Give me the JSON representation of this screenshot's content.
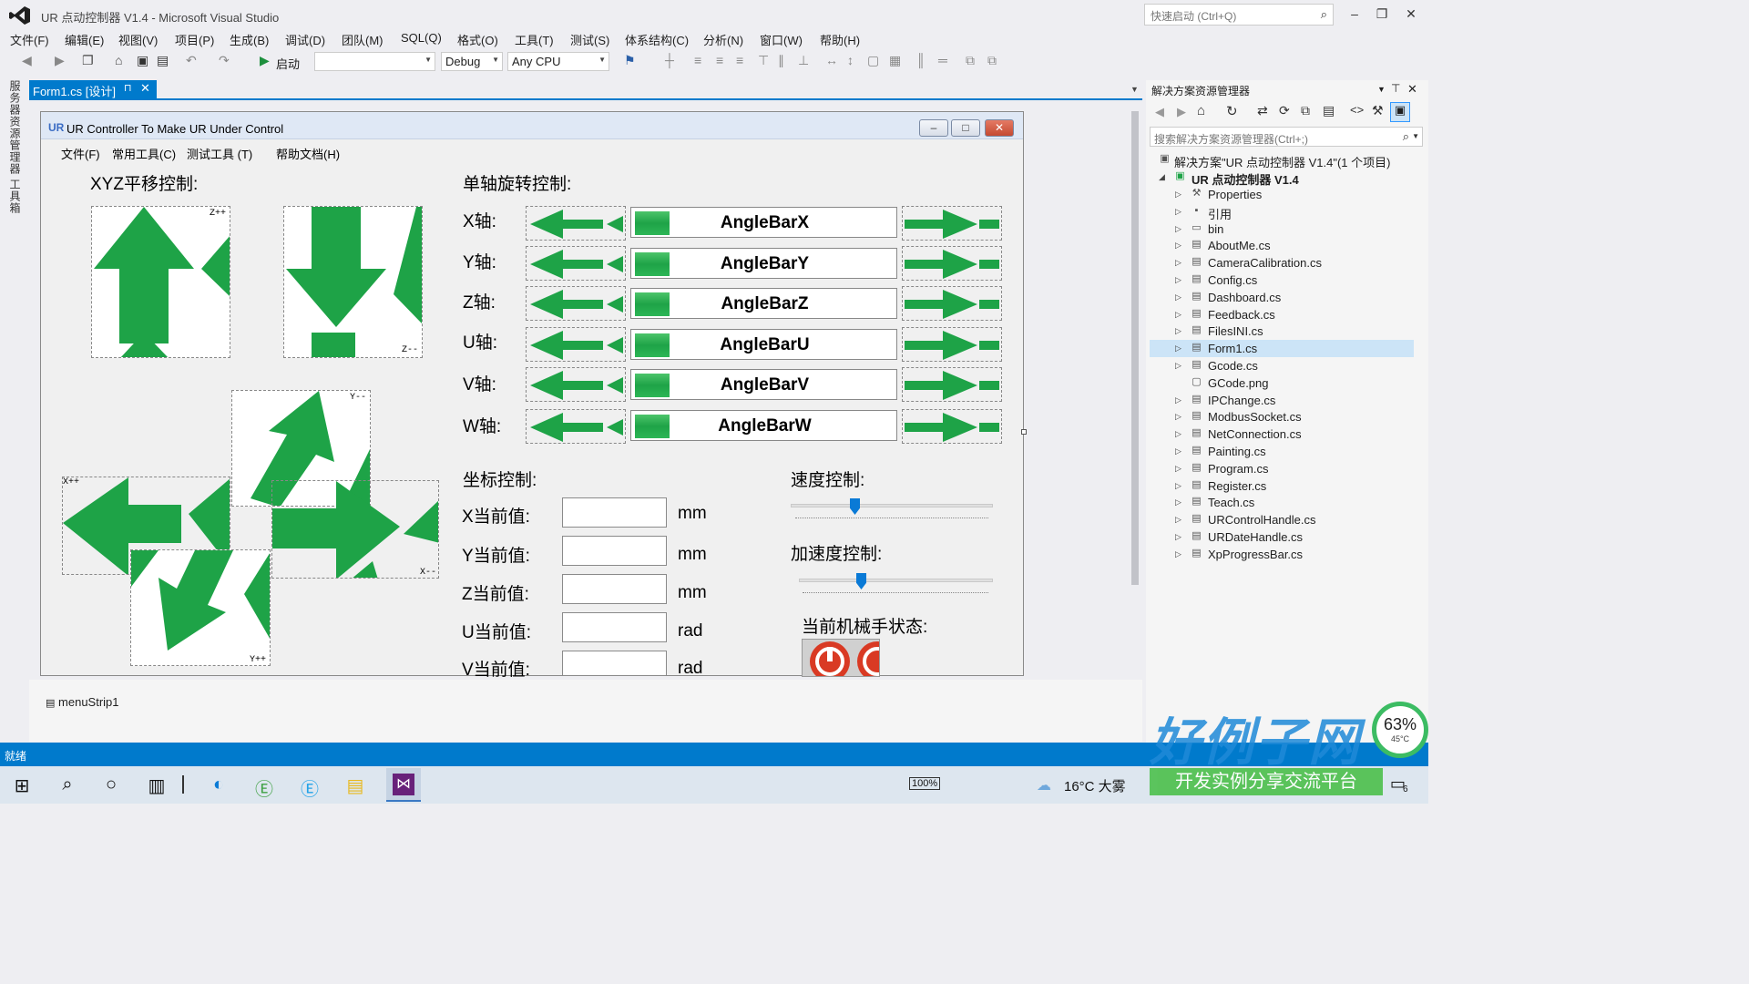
{
  "window": {
    "title": "UR 点动控制器 V1.4 - Microsoft Visual Studio",
    "quick_launch_placeholder": "快速启动 (Ctrl+Q)"
  },
  "menu": [
    "文件(F)",
    "编辑(E)",
    "视图(V)",
    "项目(P)",
    "生成(B)",
    "调试(D)",
    "团队(M)",
    "SQL(Q)",
    "格式(O)",
    "工具(T)",
    "测试(S)",
    "体系结构(C)",
    "分析(N)",
    "窗口(W)",
    "帮助(H)"
  ],
  "toolbar": {
    "start_label": "启动",
    "config": "Debug",
    "platform": "Any CPU"
  },
  "left_strip": [
    "服务器资源管理器",
    "工具箱"
  ],
  "doc_tab": {
    "label": "Form1.cs [设计]"
  },
  "form": {
    "title": "UR Controller  To Make UR Under Control",
    "logo": "UR",
    "menu": [
      "文件(F)",
      "常用工具(C)",
      "测试工具 (T)",
      "帮助文档(H)"
    ],
    "xyz_title": "XYZ平移控制:",
    "rot_title": "单轴旋转控制:",
    "tags": {
      "zp": "Z++",
      "zm": "Z--",
      "yp": "Y++",
      "ym": "Y--",
      "xp": "X++",
      "xm": "X--"
    },
    "axes": [
      {
        "label": "X轴:",
        "bar": "AngleBarX"
      },
      {
        "label": "Y轴:",
        "bar": "AngleBarY"
      },
      {
        "label": "Z轴:",
        "bar": "AngleBarZ"
      },
      {
        "label": "U轴:",
        "bar": "AngleBarU"
      },
      {
        "label": "V轴:",
        "bar": "AngleBarV"
      },
      {
        "label": "W轴:",
        "bar": "AngleBarW"
      }
    ],
    "coord_title": "坐标控制:",
    "coords": [
      {
        "label": "X当前值:",
        "unit": "mm"
      },
      {
        "label": "Y当前值:",
        "unit": "mm"
      },
      {
        "label": "Z当前值:",
        "unit": "mm"
      },
      {
        "label": "U当前值:",
        "unit": "rad"
      },
      {
        "label": "V当前值:",
        "unit": "rad"
      }
    ],
    "speed_title": "速度控制:",
    "accel_title": "加速度控制:",
    "state_title": "当前机械手状态:"
  },
  "tray": {
    "menustrip": "menuStrip1"
  },
  "solution": {
    "title": "解决方案资源管理器",
    "search_placeholder": "搜索解决方案资源管理器(Ctrl+;)",
    "solution_label": "解决方案\"UR 点动控制器 V1.4\"(1 个项目)",
    "project_label": "UR 点动控制器 V1.4",
    "items": [
      "Properties",
      "引用",
      "bin",
      "AboutMe.cs",
      "CameraCalibration.cs",
      "Config.cs",
      "Dashboard.cs",
      "Feedback.cs",
      "FilesINI.cs",
      "Form1.cs",
      "Gcode.cs",
      "GCode.png",
      "IPChange.cs",
      "ModbusSocket.cs",
      "NetConnection.cs",
      "Painting.cs",
      "Program.cs",
      "Register.cs",
      "Teach.cs",
      "URControlHandle.cs",
      "URDateHandle.cs",
      "XpProgressBar.cs"
    ]
  },
  "status": {
    "text": "就绪"
  },
  "taskbar": {
    "battery": "100%",
    "weather": "16°C 大雾",
    "notifications": "6"
  },
  "overlay": {
    "brand": "好例子网",
    "slogan": "开发实例分享交流平台",
    "cpu": "63%",
    "temp": "45°C"
  }
}
